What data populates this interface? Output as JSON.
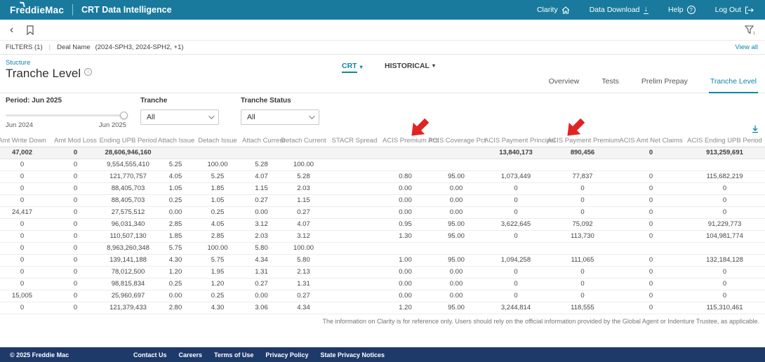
{
  "topbar": {
    "logo_text": "FreddieMac",
    "app_title": "CRT Data Intelligence",
    "nav": [
      {
        "label": "Clarity",
        "icon": "home-icon"
      },
      {
        "label": "Data Download",
        "icon": "download-icon"
      },
      {
        "label": "Help",
        "icon": "help-icon"
      },
      {
        "label": "Log Out",
        "icon": "logout-icon"
      }
    ]
  },
  "toolbar": {
    "back_icon": "‹"
  },
  "filters_bar": {
    "filters_label": "FILTERS (1)",
    "separator": "|",
    "deal_name_label": "Deal Name",
    "deal_name_value": "(2024-SPH3, 2024-SPH2, +1)",
    "view_all_label": "View all"
  },
  "page_header": {
    "breadcrumb": "Stucture",
    "title": "Tranche Level",
    "crt_menu": "CRT",
    "historical_menu": "HISTORICAL",
    "tabs": [
      {
        "label": "Overview",
        "active": false
      },
      {
        "label": "Tests",
        "active": false
      },
      {
        "label": "Prelim Prepay",
        "active": false
      },
      {
        "label": "Tranche Level",
        "active": true
      }
    ]
  },
  "controls": {
    "period": {
      "label": "Period: Jun 2025",
      "range_start": "Jun 2024",
      "range_end": "Jun 2025"
    },
    "tranche": {
      "label": "Tranche",
      "value": "All"
    },
    "tranche_status": {
      "label": "Tranche Status",
      "value": "All"
    }
  },
  "table": {
    "columns": [
      "Amt Write Down",
      "Amt Mod Loss",
      "Ending UPB Period",
      "Attach Issue",
      "Detach Issue",
      "Attach Current",
      "Detach Current",
      "STACR Spread",
      "ACIS Premium Pct",
      "ACIS Coverage Pct",
      "ACIS Payment Principal",
      "ACIS Payment Premium",
      "ACIS Amt Net Claims",
      "ACIS Ending UPB Period"
    ],
    "arrow_annotated_columns": [
      "ACIS Premium Pct",
      "ACIS Payment Premium"
    ],
    "totals_row": [
      "47,002",
      "0",
      "28,606,946,160",
      "",
      "",
      "",
      "",
      "",
      "",
      "",
      "13,840,173",
      "890,456",
      "0",
      "913,259,691"
    ],
    "rows": [
      [
        "0",
        "0",
        "9,554,555,410",
        "5.25",
        "100.00",
        "5.28",
        "100.00",
        "",
        "",
        "",
        "",
        "",
        "",
        ""
      ],
      [
        "0",
        "0",
        "121,770,757",
        "4.05",
        "5.25",
        "4.07",
        "5.28",
        "",
        "0.80",
        "95.00",
        "1,073,449",
        "77,837",
        "0",
        "115,682,219"
      ],
      [
        "0",
        "0",
        "88,405,703",
        "1.05",
        "1.85",
        "1.15",
        "2.03",
        "",
        "0.00",
        "0.00",
        "0",
        "0",
        "0",
        "0"
      ],
      [
        "0",
        "0",
        "88,405,703",
        "0.25",
        "1.05",
        "0.27",
        "1.15",
        "",
        "0.00",
        "0.00",
        "0",
        "0",
        "0",
        "0"
      ],
      [
        "24,417",
        "0",
        "27,575,512",
        "0.00",
        "0.25",
        "0.00",
        "0.27",
        "",
        "0.00",
        "0.00",
        "0",
        "0",
        "0",
        "0"
      ],
      [
        "0",
        "0",
        "96,031,340",
        "2.85",
        "4.05",
        "3.12",
        "4.07",
        "",
        "0.95",
        "95.00",
        "3,622,645",
        "75,092",
        "0",
        "91,229,773"
      ],
      [
        "0",
        "0",
        "110,507,130",
        "1.85",
        "2.85",
        "2.03",
        "3.12",
        "",
        "1.30",
        "95.00",
        "0",
        "113,730",
        "0",
        "104,981,774"
      ],
      [
        "0",
        "0",
        "8,963,260,348",
        "5.75",
        "100.00",
        "5.80",
        "100.00",
        "",
        "",
        "",
        "",
        "",
        "",
        ""
      ],
      [
        "0",
        "0",
        "139,141,188",
        "4.30",
        "5.75",
        "4.34",
        "5.80",
        "",
        "1.00",
        "95.00",
        "1,094,258",
        "111,065",
        "0",
        "132,184,128"
      ],
      [
        "0",
        "0",
        "78,012,500",
        "1.20",
        "1.95",
        "1.31",
        "2.13",
        "",
        "0.00",
        "0.00",
        "0",
        "0",
        "0",
        "0"
      ],
      [
        "0",
        "0",
        "98,815,834",
        "0.25",
        "1.20",
        "0.27",
        "1.31",
        "",
        "0.00",
        "0.00",
        "0",
        "0",
        "0",
        "0"
      ],
      [
        "15,005",
        "0",
        "25,960,697",
        "0.00",
        "0.25",
        "0.00",
        "0.27",
        "",
        "0.00",
        "0.00",
        "0",
        "0",
        "0",
        "0"
      ],
      [
        "0",
        "0",
        "121,379,433",
        "2.80",
        "4.30",
        "3.06",
        "4.34",
        "",
        "1.20",
        "95.00",
        "3,244,814",
        "118,555",
        "0",
        "115,310,461"
      ]
    ]
  },
  "disclaimer": "The information on Clarity is for reference only. Users should rely on the official information provided by the Global Agent or Indenture Trustee, as applicable.",
  "footer": {
    "copyright": "© 2025 Freddie Mac",
    "links": [
      "Contact Us",
      "Careers",
      "Terms of Use",
      "Privacy Policy",
      "State Privacy Notices"
    ]
  },
  "colors": {
    "topbar_teal": "#197a9e",
    "accent_teal": "#0f84aa",
    "footer_navy": "#1e3a68",
    "annotation_red": "#e02424"
  }
}
